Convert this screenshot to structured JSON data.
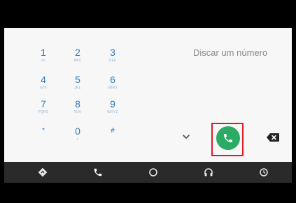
{
  "dialer": {
    "hint": "Discar um número",
    "keys": [
      {
        "num": "1",
        "sub": "oo"
      },
      {
        "num": "2",
        "sub": "ABC"
      },
      {
        "num": "3",
        "sub": "DEF"
      },
      {
        "num": "4",
        "sub": "GHI"
      },
      {
        "num": "5",
        "sub": "JKL"
      },
      {
        "num": "6",
        "sub": "MNO"
      },
      {
        "num": "7",
        "sub": "PQRS"
      },
      {
        "num": "8",
        "sub": "TUV"
      },
      {
        "num": "9",
        "sub": "WXYZ"
      },
      {
        "num": "*",
        "sub": ""
      },
      {
        "num": "0",
        "sub": "+"
      },
      {
        "num": "#",
        "sub": ""
      }
    ]
  },
  "icons": {
    "expand": "chevron-down-icon",
    "call": "phone-icon",
    "backspace": "backspace-icon"
  },
  "nav": {
    "items": [
      {
        "icon": "navigation-icon"
      },
      {
        "icon": "phone-icon"
      },
      {
        "icon": "home-circle-icon"
      },
      {
        "icon": "headphones-icon"
      },
      {
        "icon": "recent-icon"
      }
    ]
  },
  "colors": {
    "key_text": "#2b7cbf",
    "call_button": "#2cab64",
    "highlight": "#e01a25",
    "nav_background": "#2a2a2a"
  }
}
